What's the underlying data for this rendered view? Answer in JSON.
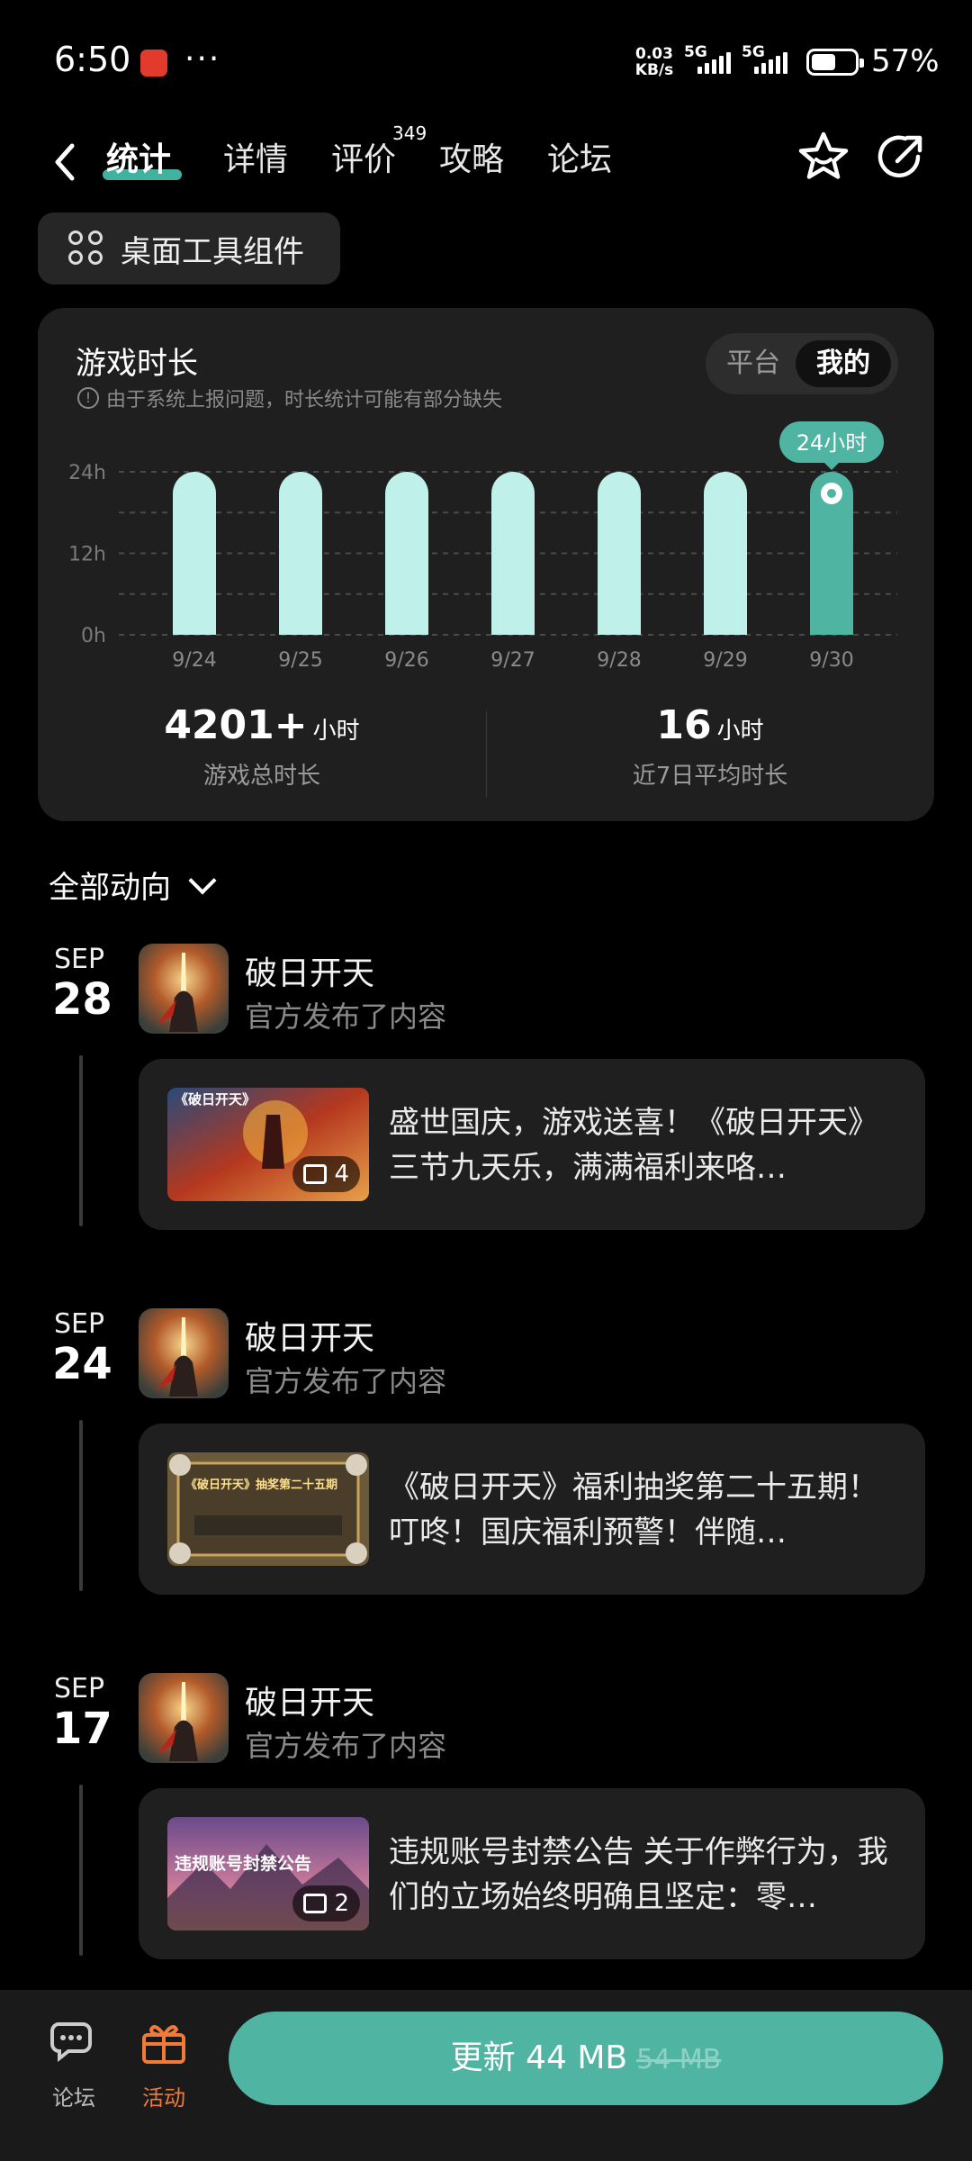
{
  "status_bar": {
    "time": "6:50",
    "more": "···",
    "speed_value": "0.03",
    "speed_unit": "KB/s",
    "net1": "5G",
    "net2": "5G",
    "battery": "57%"
  },
  "nav": {
    "tabs": [
      {
        "label": "统计"
      },
      {
        "label": "详情"
      },
      {
        "label": "评价"
      },
      {
        "label": "攻略"
      },
      {
        "label": "论坛"
      }
    ],
    "review_count": "349"
  },
  "widget_button": {
    "label": "桌面工具组件"
  },
  "stats": {
    "title": "游戏时长",
    "note": "由于系统上报问题，时长统计可能有部分缺失",
    "toggle": {
      "options": [
        "平台",
        "我的"
      ],
      "selected": "我的"
    },
    "total_value": "4201",
    "total_plus": "+",
    "total_unit": "小时",
    "total_label": "游戏总时长",
    "avg_value": "16",
    "avg_unit": "小时",
    "avg_label": "近7日平均时长"
  },
  "chart_data": {
    "type": "bar",
    "categories": [
      "9/24",
      "9/25",
      "9/26",
      "9/27",
      "9/28",
      "9/29",
      "9/30"
    ],
    "values": [
      24,
      24,
      24,
      24,
      24,
      24,
      24
    ],
    "yticks": [
      "0h",
      "12h",
      "24h"
    ],
    "ylim": [
      0,
      24
    ],
    "highlight_index": 6,
    "tooltip": "24小时",
    "colors": {
      "bar": "#bff0ea",
      "highlight": "#4fb4a2"
    }
  },
  "feed": {
    "filter_label": "全部动向",
    "items": [
      {
        "month": "SEP",
        "day": "28",
        "publisher": "破日开天",
        "action": "官方发布了内容",
        "thumb_count": "4",
        "thumb_caption": "《破日开天》",
        "text": "盛世国庆，游戏送喜！《破日开天》三节九天乐，满满福利来咯…"
      },
      {
        "month": "SEP",
        "day": "24",
        "publisher": "破日开天",
        "action": "官方发布了内容",
        "thumb_count": "",
        "thumb_caption": "《破日开天》抽奖第二十五期",
        "text": "《破日开天》福利抽奖第二十五期！ 叮咚！国庆福利预警！伴随…"
      },
      {
        "month": "SEP",
        "day": "17",
        "publisher": "破日开天",
        "action": "官方发布了内容",
        "thumb_count": "2",
        "thumb_caption": "违规账号封禁公告",
        "text": "违规账号封禁公告 关于作弊行为，我们的立场始终明确且坚定：零…"
      }
    ]
  },
  "bottom_bar": {
    "forum_label": "论坛",
    "activity_label": "活动",
    "update_label": "更新 44 MB",
    "update_old_size": "54 MB"
  }
}
